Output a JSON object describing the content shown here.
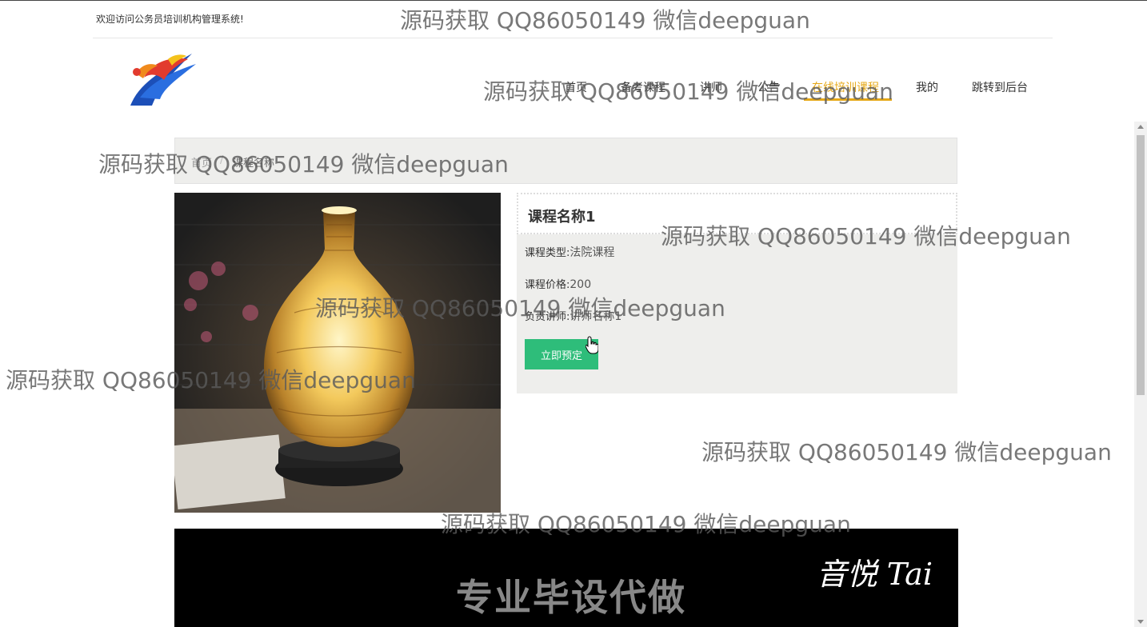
{
  "header": {
    "welcome": "欢迎访问公务员培训机构管理系统!"
  },
  "nav": {
    "items": [
      {
        "label": "首页"
      },
      {
        "label": "备考课程"
      },
      {
        "label": "讲师"
      },
      {
        "label": "公告"
      },
      {
        "label": "在线培训课程"
      },
      {
        "label": "我的"
      },
      {
        "label": "跳转到后台"
      }
    ],
    "active_index": 4,
    "accent_color": "#e6a817"
  },
  "breadcrumb": {
    "home": "首页",
    "separator": "/",
    "current": "课程名称"
  },
  "course": {
    "title": "课程名称1",
    "type_label": "课程类型:",
    "type_value": "法院课程",
    "price_label": "课程价格:",
    "price_value": "200",
    "teacher_label": "负责讲师:",
    "teacher_value": "讲师名称1",
    "book_button": "立即预定",
    "button_color": "#2ebd7a"
  },
  "video": {
    "signature": "音悦 Tai",
    "caption": "专业毕设代做"
  },
  "watermarks": [
    "源码获取 QQ86050149 微信deepguan",
    "源码获取 QQ86050149 微信deepguan",
    "源码获取 QQ86050149 微信deepguan",
    "源码获取 QQ86050149 微信deepguan",
    "源码获取 QQ86050149 微信deepguan",
    "源码获取 QQ86050149 微信deepguan",
    "源码获取 QQ86050149 微信deepguan",
    "源码获取 QQ86050149 微信deepguan"
  ]
}
